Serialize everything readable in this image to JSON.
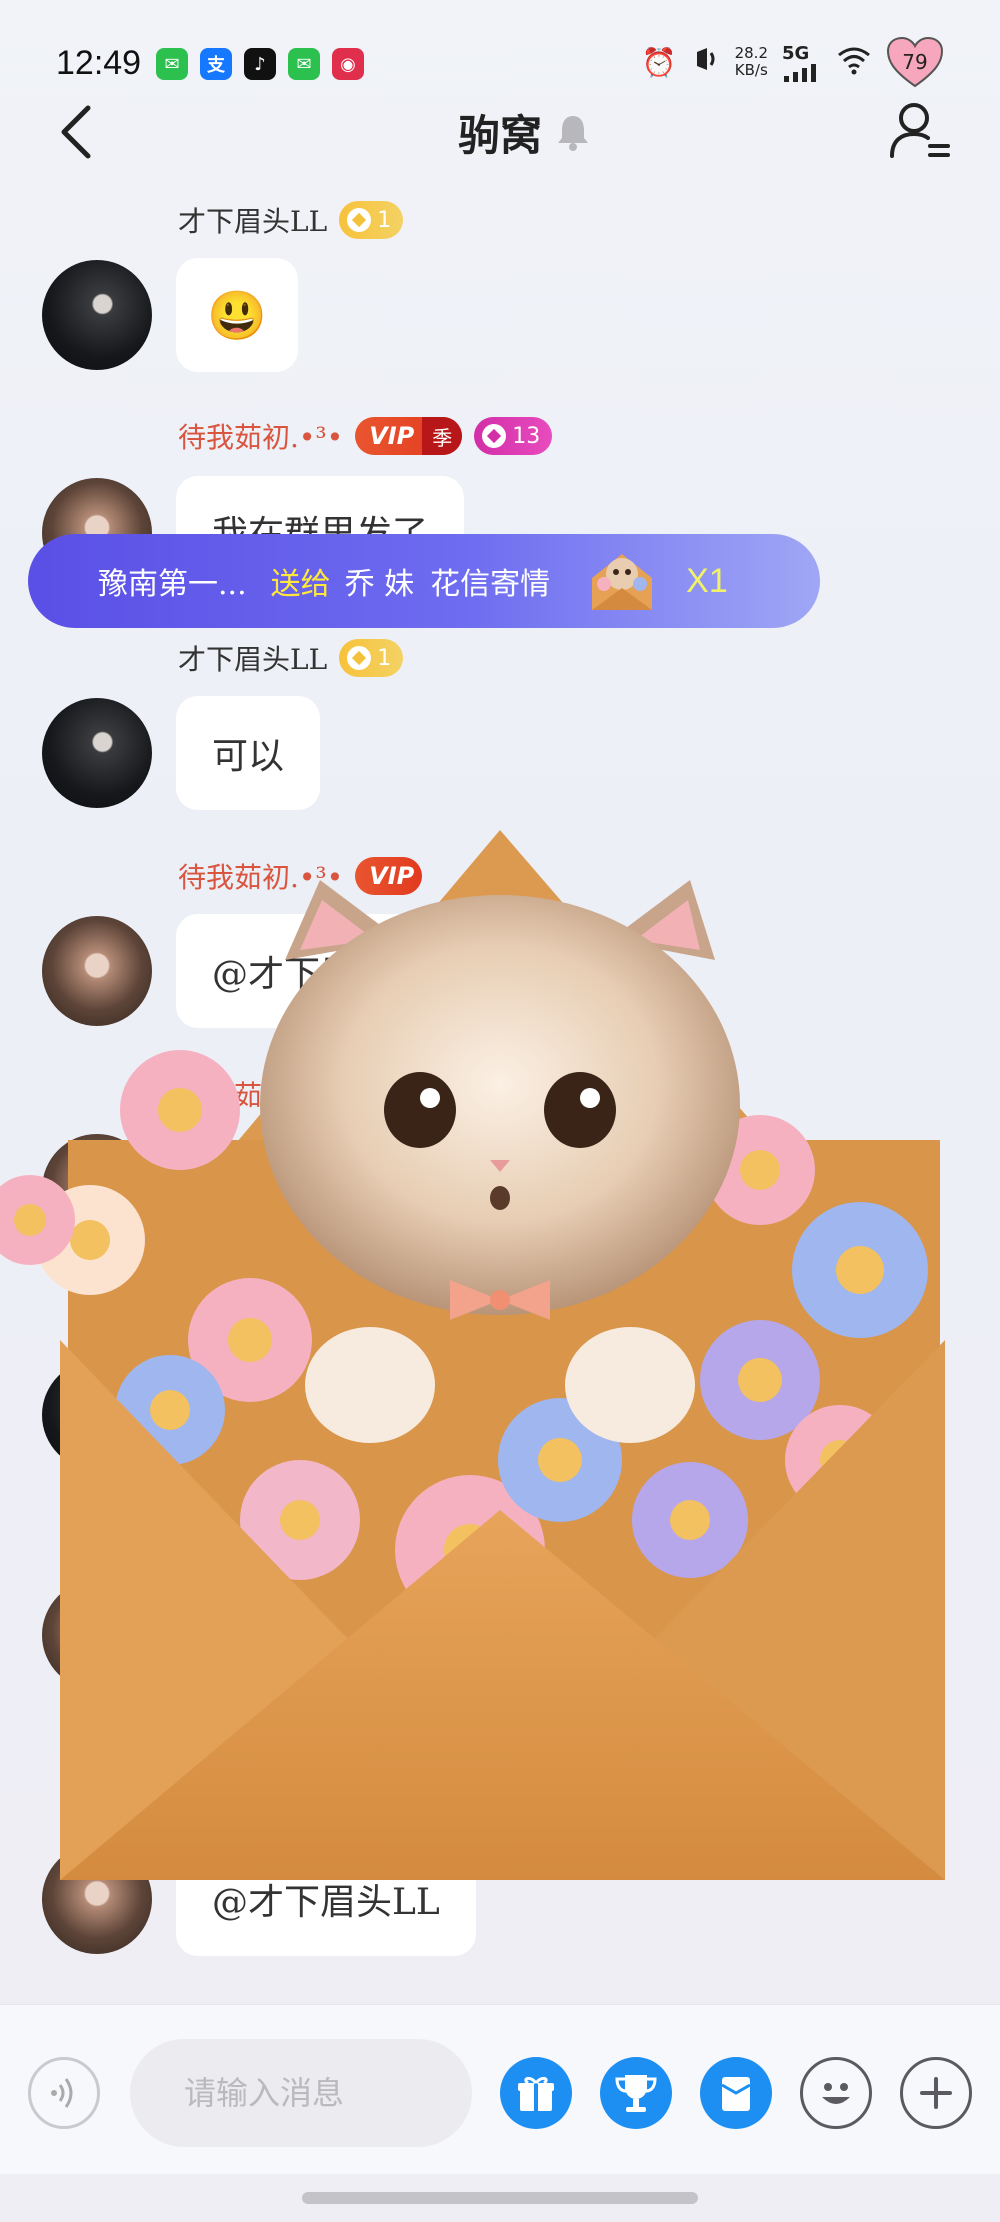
{
  "status_bar": {
    "time": "12:49",
    "apps": [
      {
        "icon": "wechat-icon",
        "glyph": "✉",
        "color": "#2cc14f"
      },
      {
        "icon": "alipay-icon",
        "glyph": "支",
        "color": "#1677ff"
      },
      {
        "icon": "douyin-icon",
        "glyph": "♪",
        "color": "#111111"
      },
      {
        "icon": "wechat-icon",
        "glyph": "✉",
        "color": "#2cc14f"
      },
      {
        "icon": "pinduoduo-icon",
        "glyph": "◉",
        "color": "#e02e4d"
      }
    ],
    "speed_value": "28.2",
    "speed_unit": "KB/s",
    "network": "5G",
    "battery": "79"
  },
  "header": {
    "title": "驹窝",
    "muted": true
  },
  "messages": [
    {
      "sender": "才下眉头LL",
      "level": "1",
      "text": "😃"
    },
    {
      "sender": "待我茹初.•³•",
      "vip": "VIP",
      "season": "季",
      "level": "13",
      "text": "我在群里发了"
    },
    {
      "sender": "才下眉头LL",
      "level": "1",
      "text": "可以"
    },
    {
      "sender": "待我茹初.•³•",
      "vip": "VIP",
      "text": "@才下眉头LL 送给你"
    },
    {
      "sender": "待我茹初",
      "text": "@才下眉头LL"
    }
  ],
  "gift_banner": {
    "sender": "豫南第一...",
    "verb": "送给",
    "receiver": "乔 妹",
    "gift_name": "花信寄情",
    "count": "X1"
  },
  "input": {
    "placeholder": "请输入消息"
  },
  "colors": {
    "accent_blue": "#1d8ff3",
    "vip_red": "#e23a1f",
    "level_gold": "#f4c23a",
    "level_pink": "#d22ea8",
    "name_red": "#d9553f"
  }
}
